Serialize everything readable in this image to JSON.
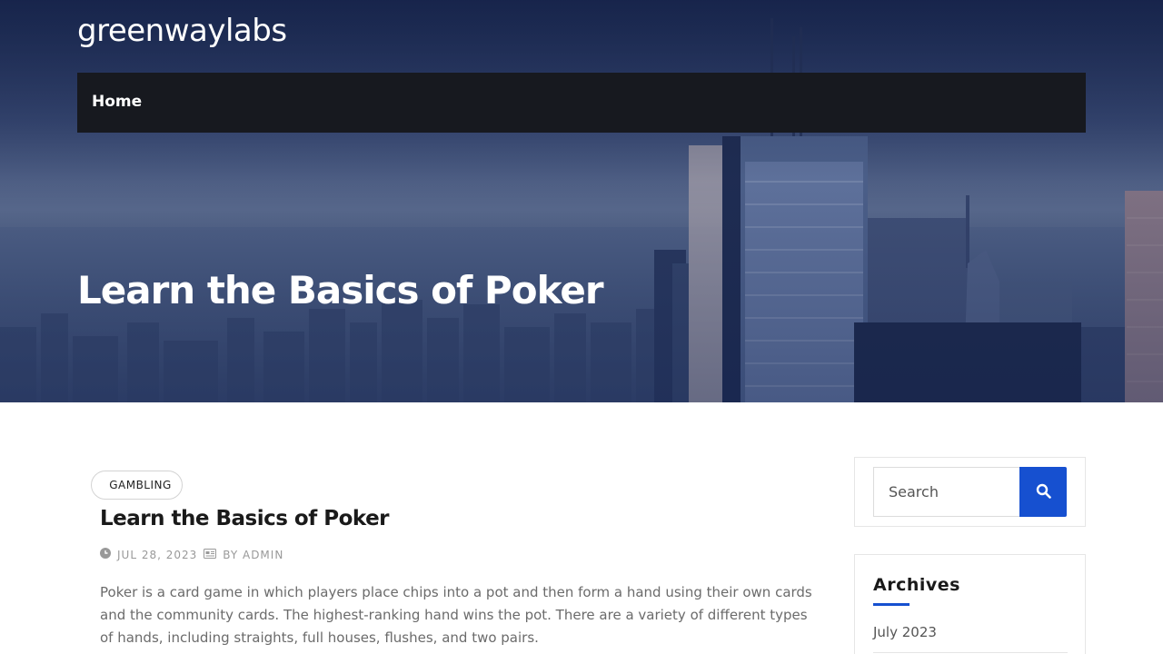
{
  "site": {
    "title": "greenwaylabs"
  },
  "nav": {
    "items": [
      {
        "label": "Home"
      }
    ]
  },
  "hero": {
    "title": "Learn the Basics of Poker"
  },
  "post": {
    "category": "GAMBLING",
    "title": "Learn the Basics of Poker",
    "date": "JUL 28, 2023",
    "author": "BY ADMIN",
    "excerpt": "Poker is a card game in which players place chips into a pot and then form a hand using their own cards and the community cards. The highest-ranking hand wins the pot. There are a variety of different types of hands, including straights, full houses, flushes, and two pairs."
  },
  "sidebar": {
    "search": {
      "placeholder": "Search",
      "value": ""
    },
    "archives": {
      "title": "Archives",
      "items": [
        {
          "label": "July 2023"
        }
      ]
    }
  },
  "colors": {
    "accent": "#1650d0",
    "navbar": "#17191f",
    "hero_tint": "#1b2a52"
  },
  "icons": {
    "search": "search-icon",
    "clock": "clock-icon",
    "author": "author-icon"
  }
}
